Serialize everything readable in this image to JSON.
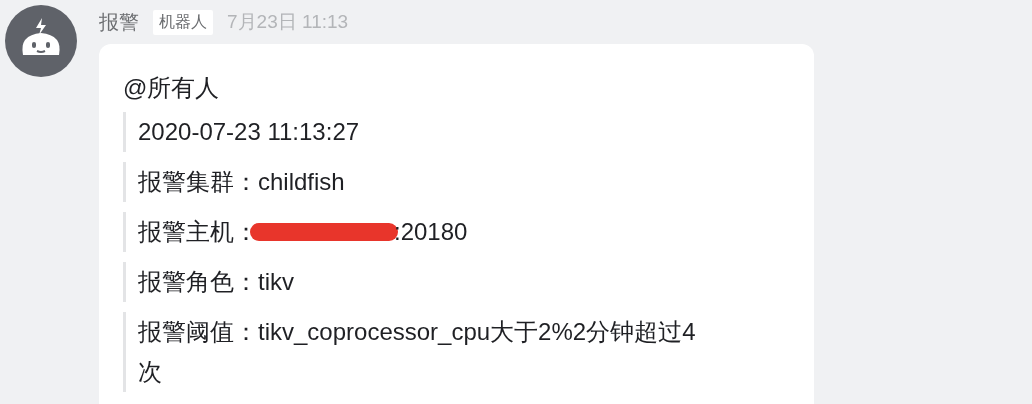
{
  "message": {
    "sender": "报警",
    "badge": "机器人",
    "time": "7月23日 11:13",
    "mention": "@所有人",
    "lines": [
      {
        "value": "2020-07-23 11:13:27",
        "redacted": false
      },
      {
        "label": "报警集群：",
        "value": "childfish",
        "redacted": false
      },
      {
        "label": "报警主机：",
        "value": ":20180",
        "redacted": true
      },
      {
        "label": "报警角色：",
        "value": "tikv",
        "redacted": false
      },
      {
        "label": "报警阈值：",
        "value": "tikv_coprocessor_cpu大于2%2分钟超过4次",
        "redacted": false
      }
    ]
  }
}
